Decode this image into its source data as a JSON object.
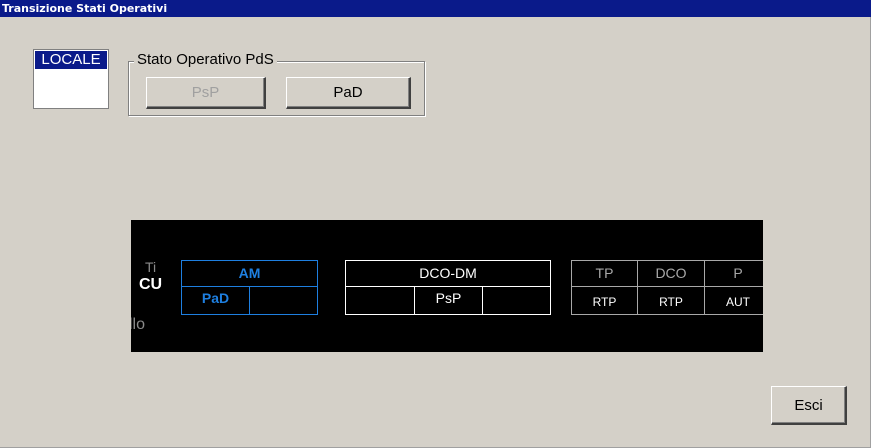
{
  "window": {
    "title": "Transizione Stati Operativi"
  },
  "locale": {
    "label": "LOCALE"
  },
  "stato_operativo": {
    "legend": "Stato Operativo PdS",
    "psp_label": "PsP",
    "psp_enabled": false,
    "pad_label": "PaD",
    "pad_enabled": true
  },
  "panel": {
    "side_ti": "Ti",
    "side_cu": "CU",
    "side_llo": "llo",
    "am": {
      "title": "AM",
      "cell1": "PaD",
      "cell2": ""
    },
    "dco_dm": {
      "title": "DCO-DM",
      "cell1": "",
      "cell2": "PsP",
      "cell3": ""
    },
    "right": {
      "tp": "TP",
      "dco": "DCO",
      "p": "P",
      "rtp1": "RTP",
      "rtp2": "RTP",
      "aut": "AUT"
    },
    "colors": {
      "am": "#1e7fe0",
      "dco_dm": "#ffffff",
      "right_header": "#a8a8a8"
    }
  },
  "footer": {
    "esci_label": "Esci"
  }
}
